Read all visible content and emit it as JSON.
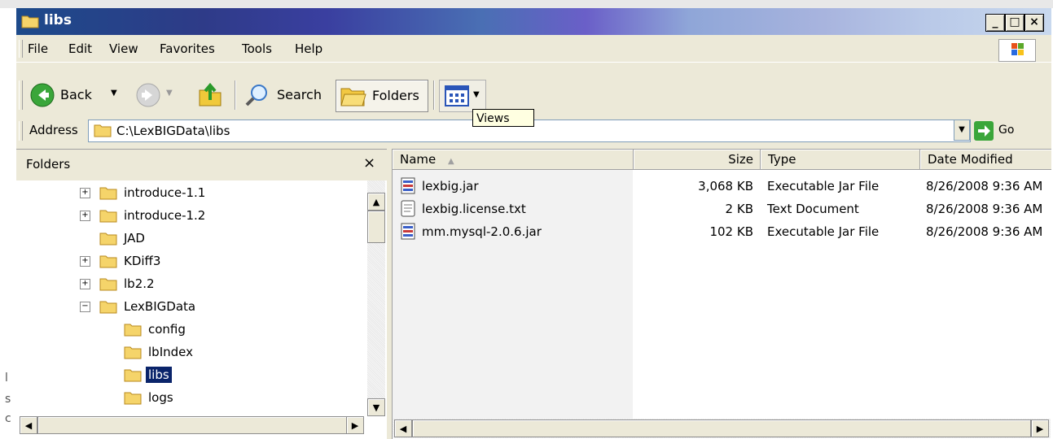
{
  "window": {
    "title": "libs"
  },
  "menu": [
    "File",
    "Edit",
    "View",
    "Favorites",
    "Tools",
    "Help"
  ],
  "toolbar": {
    "back_label": "Back",
    "search_label": "Search",
    "folders_label": "Folders",
    "views_tooltip": "Views"
  },
  "address": {
    "label": "Address",
    "value": "C:\\LexBIGData\\libs",
    "go_label": "Go"
  },
  "folders_pane": {
    "title": "Folders",
    "close_label": "×",
    "items": [
      {
        "label": "introduce-1.1",
        "expander": "+"
      },
      {
        "label": "introduce-1.2",
        "expander": "+"
      },
      {
        "label": "JAD",
        "expander": ""
      },
      {
        "label": "KDiff3",
        "expander": "+"
      },
      {
        "label": "lb2.2",
        "expander": "+"
      },
      {
        "label": "LexBIGData",
        "expander": "−"
      },
      {
        "label": "config",
        "expander": ""
      },
      {
        "label": "lbIndex",
        "expander": ""
      },
      {
        "label": "libs",
        "expander": ""
      },
      {
        "label": "logs",
        "expander": ""
      }
    ]
  },
  "file_list": {
    "columns": [
      "Name",
      "Size",
      "Type",
      "Date Modified"
    ],
    "rows": [
      {
        "name": "lexbig.jar",
        "size": "3,068 KB",
        "type": "Executable Jar File",
        "date": "8/26/2008 9:36 AM"
      },
      {
        "name": "lexbig.license.txt",
        "size": "2 KB",
        "type": "Text Document",
        "date": "8/26/2008 9:36 AM"
      },
      {
        "name": "mm.mysql-2.0.6.jar",
        "size": "102 KB",
        "type": "Executable Jar File",
        "date": "8/26/2008 9:36 AM"
      }
    ]
  },
  "background": {
    "marks": [
      "l",
      "s",
      "c"
    ]
  }
}
